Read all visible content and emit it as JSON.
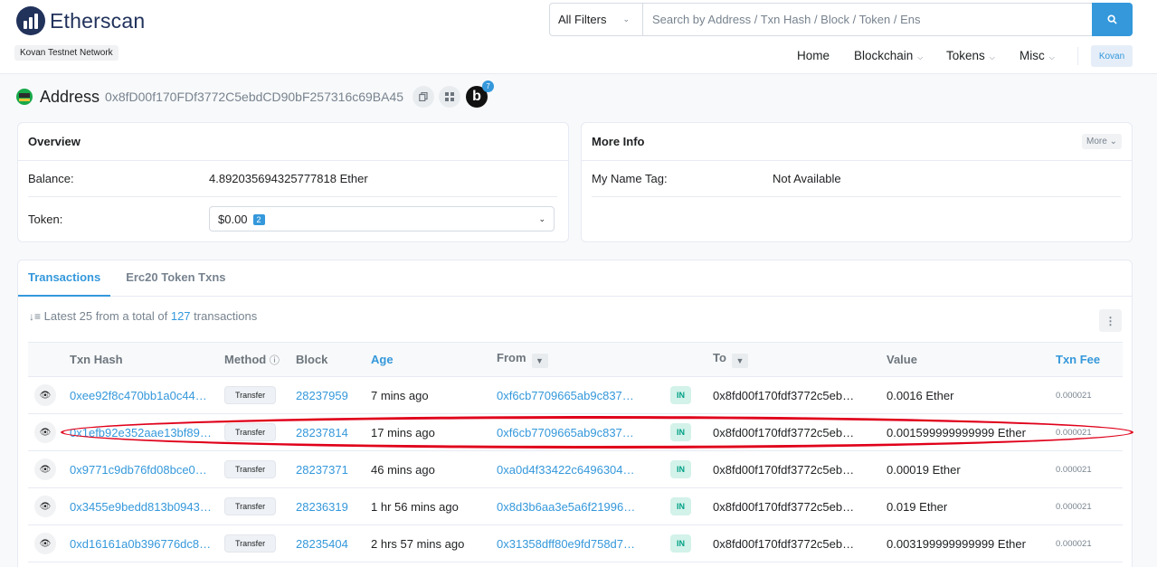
{
  "header": {
    "brand": "Etherscan",
    "network": "Kovan Testnet Network",
    "search": {
      "filter_label": "All Filters",
      "placeholder": "Search by Address / Txn Hash / Block / Token / Ens"
    },
    "nav": [
      {
        "label": "Home"
      },
      {
        "label": "Blockchain"
      },
      {
        "label": "Tokens"
      },
      {
        "label": "Misc"
      }
    ],
    "network_button": "Kovan"
  },
  "address": {
    "label": "Address",
    "hash": "0x8fD00f170FDf3772C5ebdCD90bF257316c69BA45",
    "badge_letter": "b",
    "badge_count": "7"
  },
  "overview": {
    "title": "Overview",
    "balance_label": "Balance:",
    "balance_value": "4.892035694325777818 Ether",
    "token_label": "Token:",
    "token_value": "$0.00",
    "token_count": "2"
  },
  "more_info": {
    "title": "More Info",
    "more_button": "More",
    "name_tag_label": "My Name Tag:",
    "name_tag_value": "Not Available"
  },
  "tabs": [
    {
      "label": "Transactions",
      "active": true
    },
    {
      "label": "Erc20 Token Txns",
      "active": false
    }
  ],
  "summary": {
    "prefix": "Latest 25 from a total of",
    "count": "127",
    "suffix": "transactions"
  },
  "table": {
    "headers": {
      "txn_hash": "Txn Hash",
      "method": "Method",
      "block": "Block",
      "age": "Age",
      "from": "From",
      "to": "To",
      "value": "Value",
      "txn_fee": "Txn Fee"
    },
    "rows": [
      {
        "hash": "0xee92f8c470bb1a0c44…",
        "method": "Transfer",
        "block": "28237959",
        "age": "7 mins ago",
        "from": "0xf6cb7709665ab9c837…",
        "direction": "IN",
        "to": "0x8fd00f170fdf3772c5eb…",
        "value": "0.0016 Ether",
        "fee": "0.000021"
      },
      {
        "hash": "0x1efb92e352aae13bf89…",
        "method": "Transfer",
        "block": "28237814",
        "age": "17 mins ago",
        "from": "0xf6cb7709665ab9c837…",
        "direction": "IN",
        "to": "0x8fd00f170fdf3772c5eb…",
        "value": "0.001599999999999 Ether",
        "fee": "0.000021"
      },
      {
        "hash": "0x9771c9db76fd08bce0…",
        "method": "Transfer",
        "block": "28237371",
        "age": "46 mins ago",
        "from": "0xa0d4f33422c6496304…",
        "direction": "IN",
        "to": "0x8fd00f170fdf3772c5eb…",
        "value": "0.00019 Ether",
        "fee": "0.000021"
      },
      {
        "hash": "0x3455e9bedd813b0943…",
        "method": "Transfer",
        "block": "28236319",
        "age": "1 hr 56 mins ago",
        "from": "0x8d3b6aa3e5a6f21996…",
        "direction": "IN",
        "to": "0x8fd00f170fdf3772c5eb…",
        "value": "0.019 Ether",
        "fee": "0.000021"
      },
      {
        "hash": "0xd16161a0b396776dc8…",
        "method": "Transfer",
        "block": "28235404",
        "age": "2 hrs 57 mins ago",
        "from": "0x31358dff80e9fd758d7…",
        "direction": "IN",
        "to": "0x8fd00f170fdf3772c5eb…",
        "value": "0.003199999999999 Ether",
        "fee": "0.000021"
      }
    ]
  },
  "colors": {
    "accent": "#3498db",
    "brand": "#21325b",
    "in_badge": "#00a186",
    "highlight": "#e0001a"
  },
  "icons": [
    "search-icon",
    "copy-icon",
    "qr-code-icon",
    "info-icon",
    "filter-icon",
    "eye-icon",
    "sort-icon",
    "kebab-icon",
    "chevron-down-icon"
  ]
}
